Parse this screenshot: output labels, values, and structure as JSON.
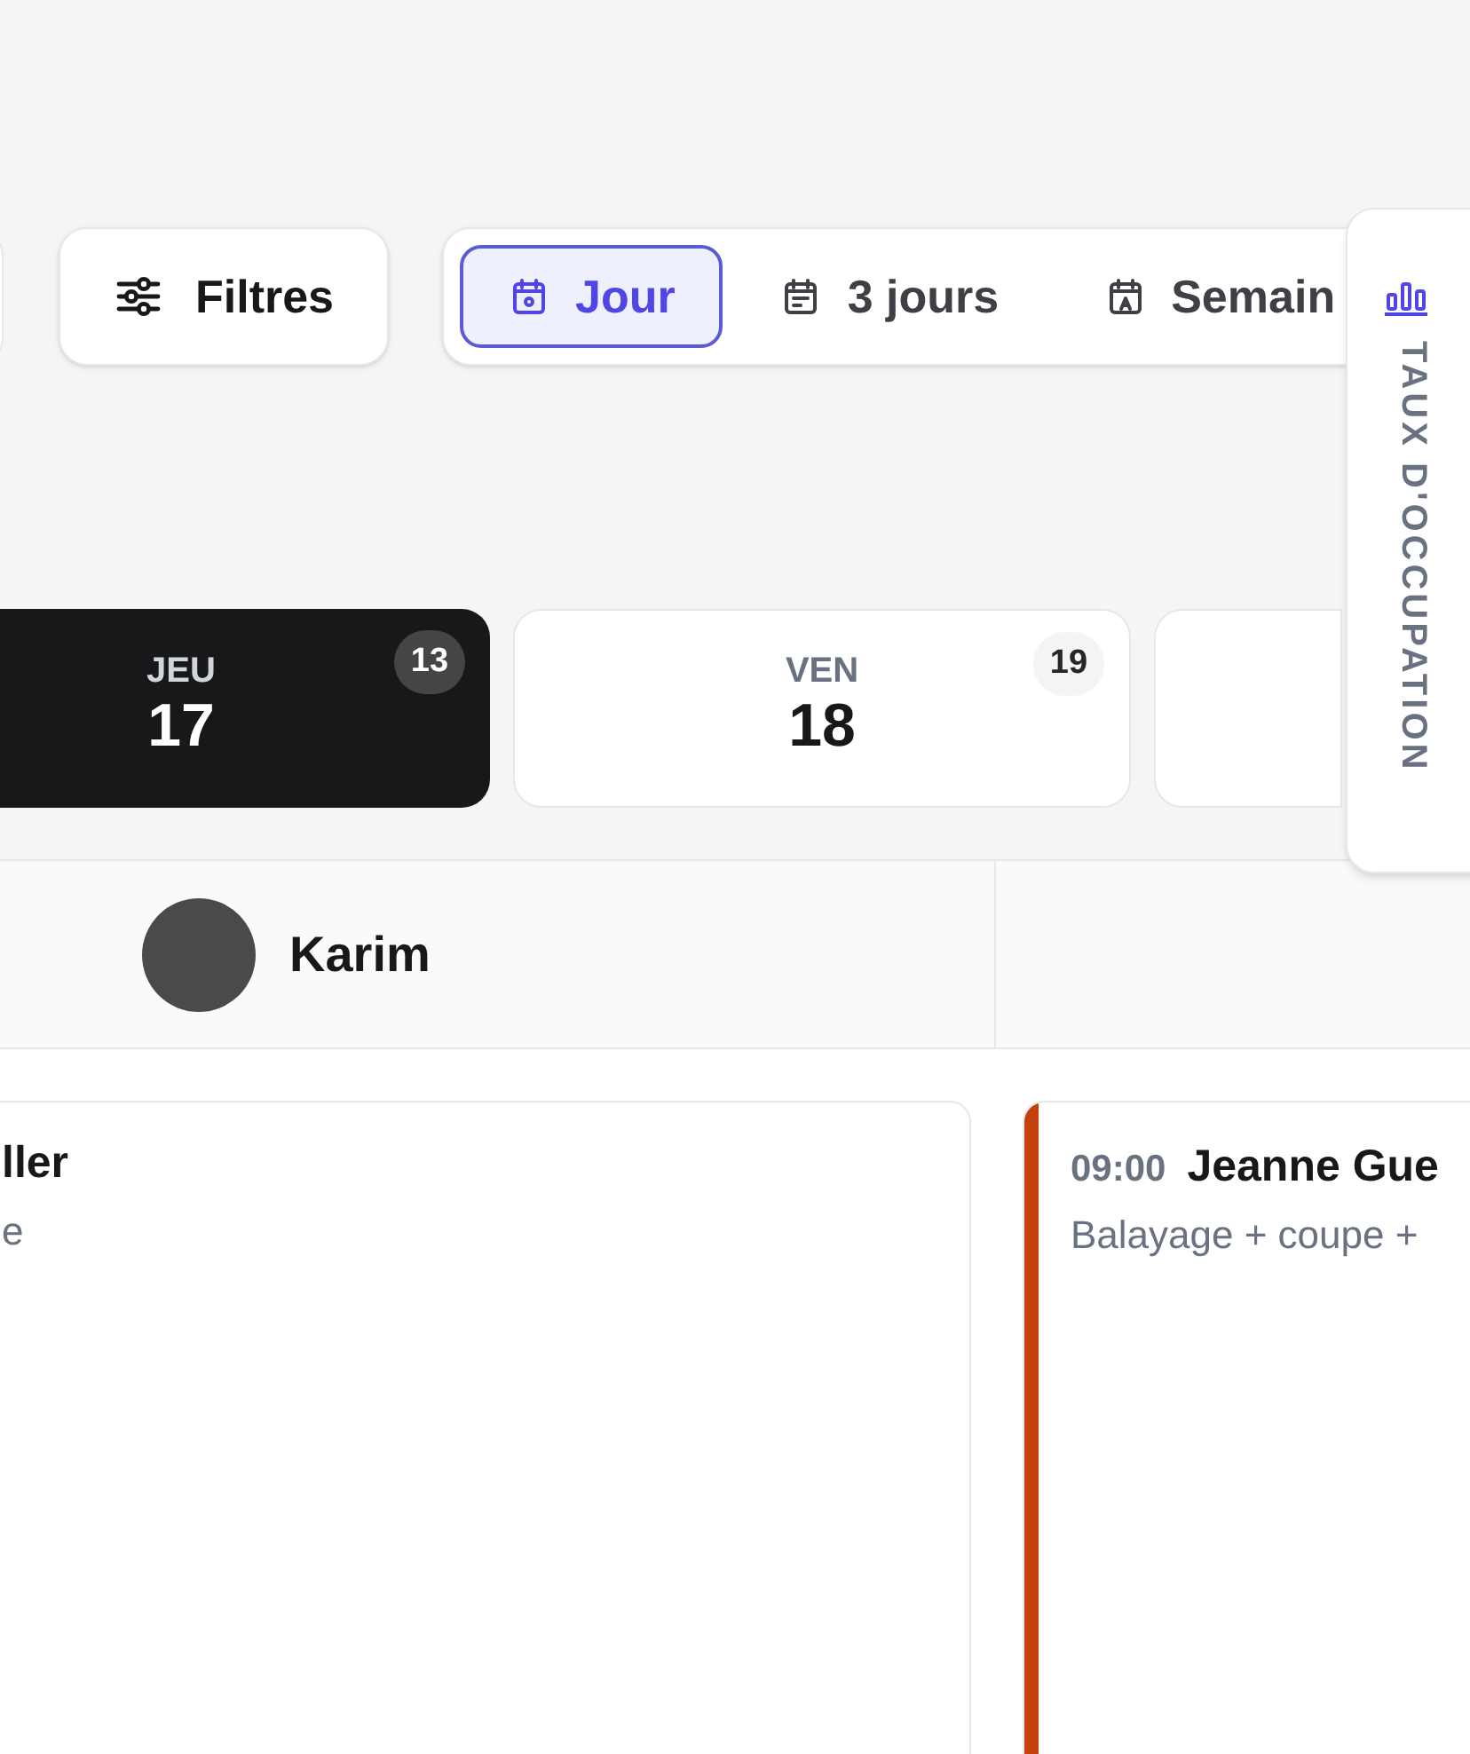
{
  "filter_button": {
    "label": "Filtres"
  },
  "view_tabs": [
    {
      "kind": "day",
      "label": "Jour",
      "selected": true
    },
    {
      "kind": "three_days",
      "label": "3 jours",
      "selected": false
    },
    {
      "kind": "week",
      "label": "Semain",
      "selected": false
    }
  ],
  "days": [
    {
      "weekday": "JEU",
      "date": "17",
      "count": "13",
      "selected": true
    },
    {
      "weekday": "VEN",
      "date": "18",
      "count": "19",
      "selected": false
    },
    {
      "selected": false
    }
  ],
  "staff": [
    {
      "name": "Karim"
    }
  ],
  "appointments": [
    {
      "title": "ller",
      "subtitle": "e"
    },
    {
      "time": "09:00",
      "title": "Jeanne Gue",
      "subtitle": "Balayage + coupe +",
      "color": "#c2410c"
    }
  ],
  "side_panel": {
    "label": "TAUX D'OCCUPATION"
  }
}
